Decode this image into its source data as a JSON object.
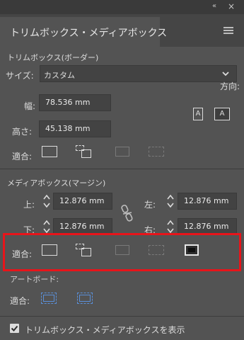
{
  "panel": {
    "tab_title": "トリムボックス・メディアボックス",
    "titlebar_collapse": "«",
    "titlebar_close": "×"
  },
  "trimbox": {
    "section_label": "トリムボックス(ボーダー)",
    "size_label": "サイズ:",
    "size_value": "カスタム",
    "width_label": "幅:",
    "width_value": "78.536 mm",
    "height_label": "高さ:",
    "height_value": "45.138 mm",
    "orientation_label": "方向:",
    "orientation_portrait": "A",
    "orientation_landscape": "A",
    "fit_label": "適合:"
  },
  "mediabox": {
    "section_label": "メディアボックス(マージン)",
    "top_label": "上:",
    "top_value": "12.876 mm",
    "left_label": "左:",
    "left_value": "12.876 mm",
    "bottom_label": "下:",
    "bottom_value": "12.876 mm",
    "right_label": "右:",
    "right_value": "12.876 mm",
    "fit_label": "適合:"
  },
  "artboard": {
    "section_label": "アートボード:",
    "fit_label": "適合:"
  },
  "show_boxes": {
    "label": "トリムボックス・メディアボックスを表示",
    "checked": true
  },
  "colors": {
    "highlight": "#e8141a",
    "accent_blue": "#5a8fd8"
  }
}
